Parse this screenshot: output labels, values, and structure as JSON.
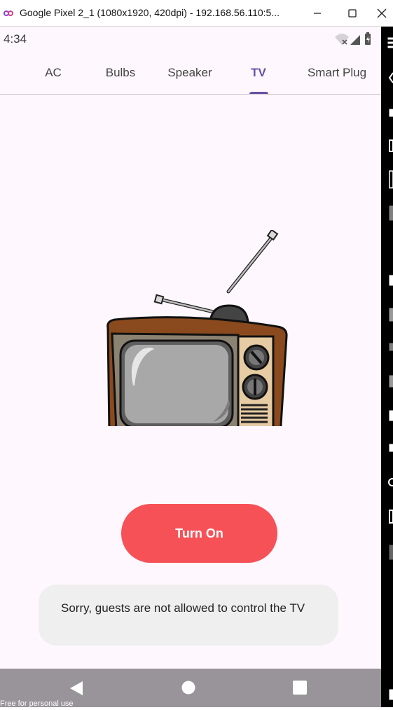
{
  "window": {
    "title": "Google Pixel 2_1 (1080x1920, 420dpi) - 192.168.56.110:5...",
    "app_icon": "infinity-icon",
    "minimize_icon": "minimize-icon",
    "maximize_icon": "maximize-icon",
    "close_icon": "close-icon"
  },
  "status_bar": {
    "time": "4:34",
    "icons": [
      "wifi-icon",
      "signal-icon",
      "battery-icon"
    ]
  },
  "tabs": [
    {
      "label": "AC",
      "active": false
    },
    {
      "label": "Bulbs",
      "active": false
    },
    {
      "label": "Speaker",
      "active": false
    },
    {
      "label": "TV",
      "active": true
    },
    {
      "label": "Smart Plug",
      "active": false
    }
  ],
  "device": {
    "image": "retro-tv-icon",
    "action_label": "Turn On",
    "action_color": "#f55157"
  },
  "toast": {
    "message": "Sorry, guests are not allowed to control the TV"
  },
  "nav_bar": {
    "back": "back-triangle-icon",
    "home": "home-circle-icon",
    "recents": "recents-square-icon"
  },
  "watermark": "Free for personal use",
  "colors": {
    "accent": "#6750a4",
    "background": "#fef7fd",
    "button": "#f55157",
    "toast": "#efefef"
  }
}
